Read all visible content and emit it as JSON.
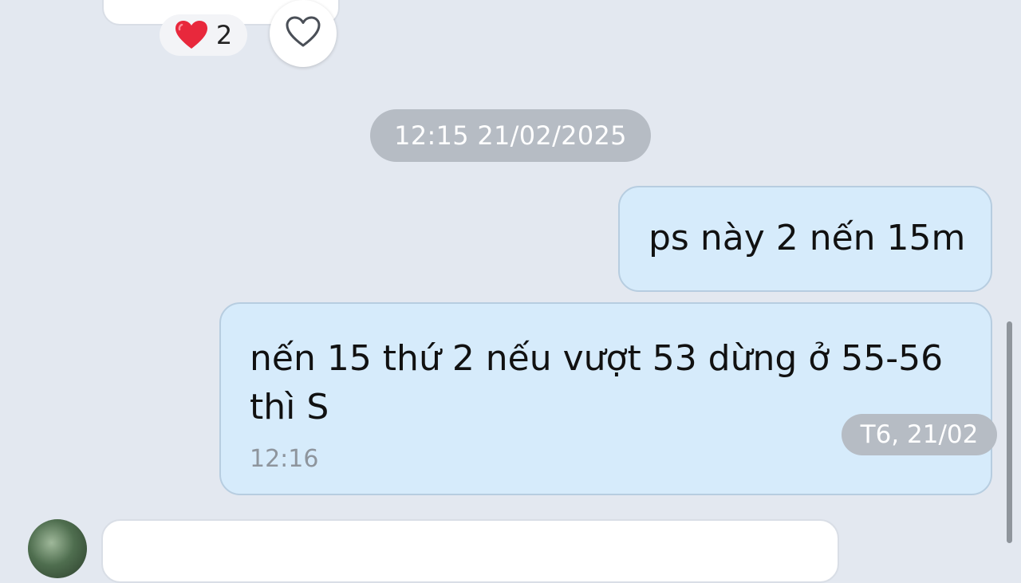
{
  "reaction": {
    "emoji_icon": "red-heart",
    "count": "2"
  },
  "like_button": {
    "icon": "heart-outline-icon"
  },
  "date_separator": "12:15 21/02/2025",
  "messages": [
    {
      "text": "ps này 2 nến 15m"
    },
    {
      "text": "nến 15 thứ 2 nếu vượt 53 dừng ở 55-56 thì S",
      "time": "12:16"
    }
  ],
  "floating_day_label": "T6, 21/02",
  "colors": {
    "background": "#e3e8f0",
    "outgoing_bubble": "#d6ebfb",
    "incoming_bubble": "#ffffff",
    "date_pill": "#b6bcc4"
  }
}
